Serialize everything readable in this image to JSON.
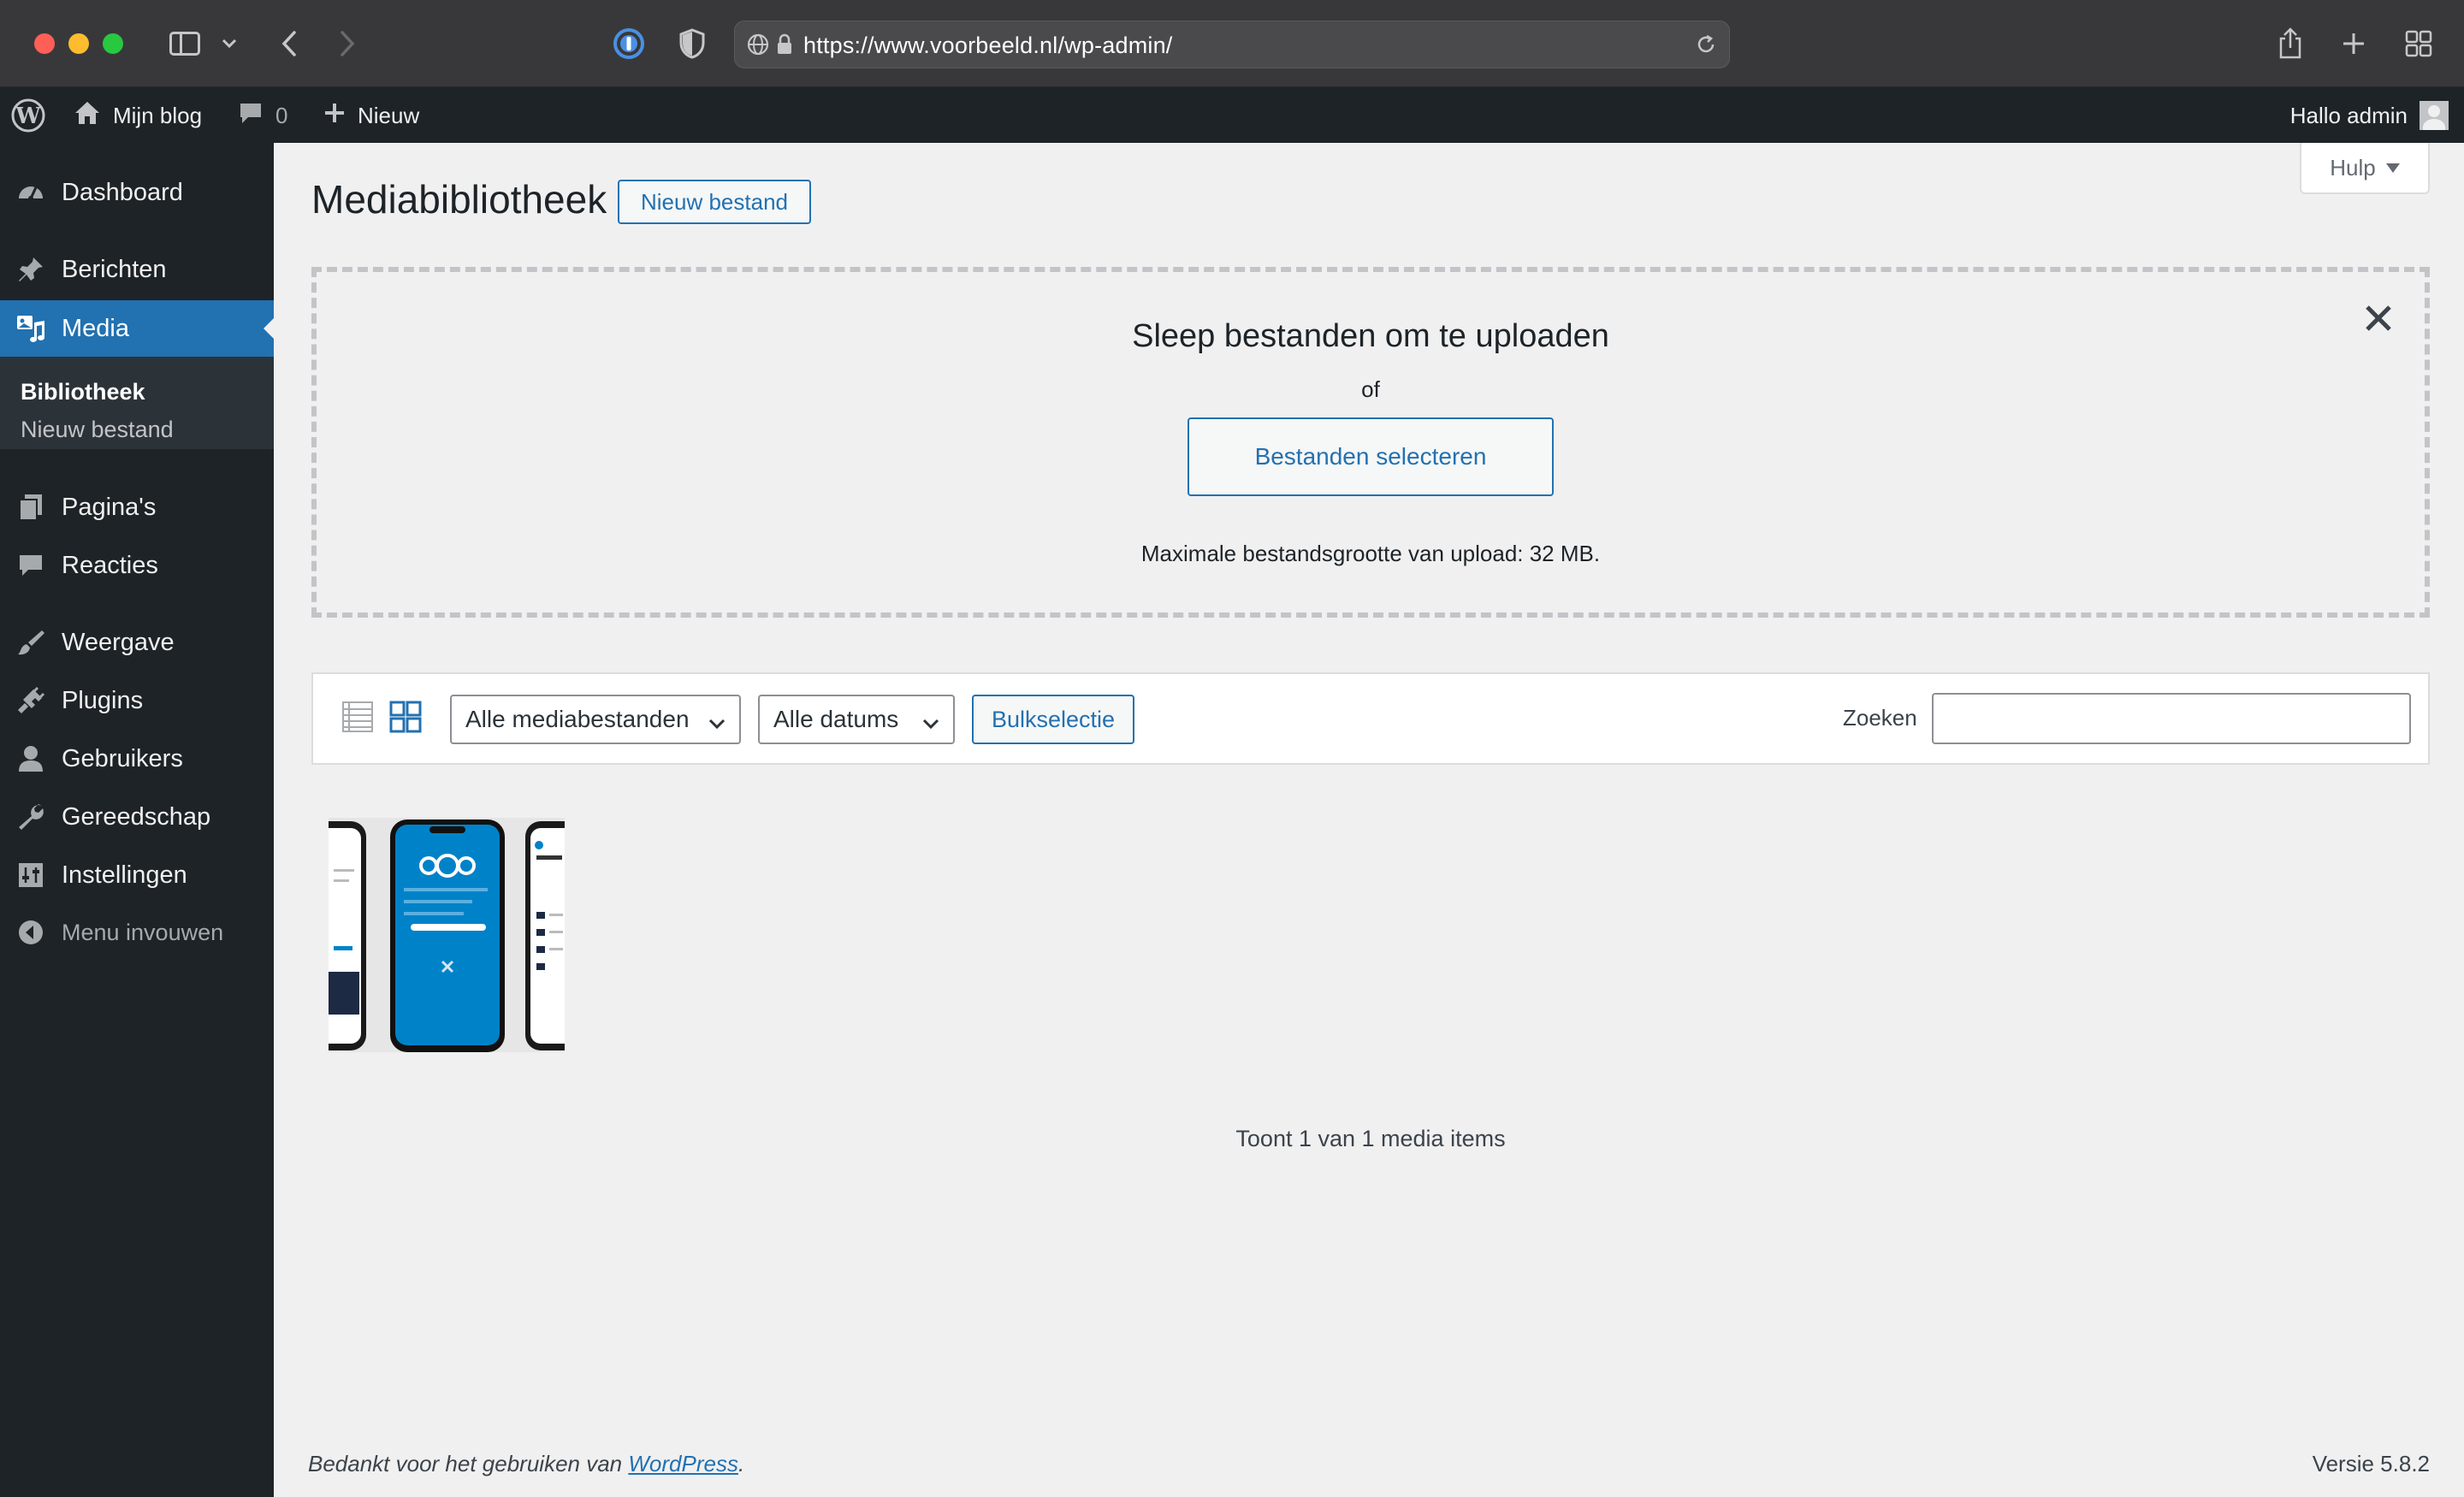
{
  "browser": {
    "url": "https://www.voorbeeld.nl/wp-admin/"
  },
  "adminbar": {
    "site_name": "Mijn blog",
    "comments_count": "0",
    "new_label": "Nieuw",
    "howdy": "Hallo admin"
  },
  "sidebar": {
    "items": [
      {
        "label": "Dashboard",
        "icon": "dashboard-icon"
      },
      {
        "label": "Berichten",
        "icon": "pin-icon"
      },
      {
        "label": "Media",
        "icon": "media-icon"
      },
      {
        "label": "Pagina's",
        "icon": "pages-icon"
      },
      {
        "label": "Reacties",
        "icon": "comments-icon"
      },
      {
        "label": "Weergave",
        "icon": "brush-icon"
      },
      {
        "label": "Plugins",
        "icon": "plugin-icon"
      },
      {
        "label": "Gebruikers",
        "icon": "user-icon"
      },
      {
        "label": "Gereedschap",
        "icon": "wrench-icon"
      },
      {
        "label": "Instellingen",
        "icon": "settings-icon"
      }
    ],
    "submenu": [
      "Bibliotheek",
      "Nieuw bestand"
    ],
    "collapse_label": "Menu invouwen"
  },
  "help_label": "Hulp",
  "page": {
    "title": "Mediabibliotheek",
    "add_new_label": "Nieuw bestand"
  },
  "uploader": {
    "title": "Sleep bestanden om te uploaden",
    "or": "of",
    "select_label": "Bestanden selecteren",
    "max_size": "Maximale bestandsgrootte van upload: 32 MB."
  },
  "toolbar": {
    "filter_type": "Alle mediabestanden",
    "filter_date": "Alle datums",
    "bulk_label": "Bulkselectie",
    "search_label": "Zoeken",
    "search_value": ""
  },
  "media": {
    "count_text": "Toont 1 van 1 media items"
  },
  "footer": {
    "thanks_prefix": "Bedankt voor het gebruiken van",
    "thanks_link": "WordPress",
    "thanks_suffix": ".",
    "version": "Versie 5.8.2"
  },
  "colors": {
    "wp_blue": "#2271b1",
    "admin_dark": "#1d2327",
    "content_bg": "#f0f0f1"
  }
}
